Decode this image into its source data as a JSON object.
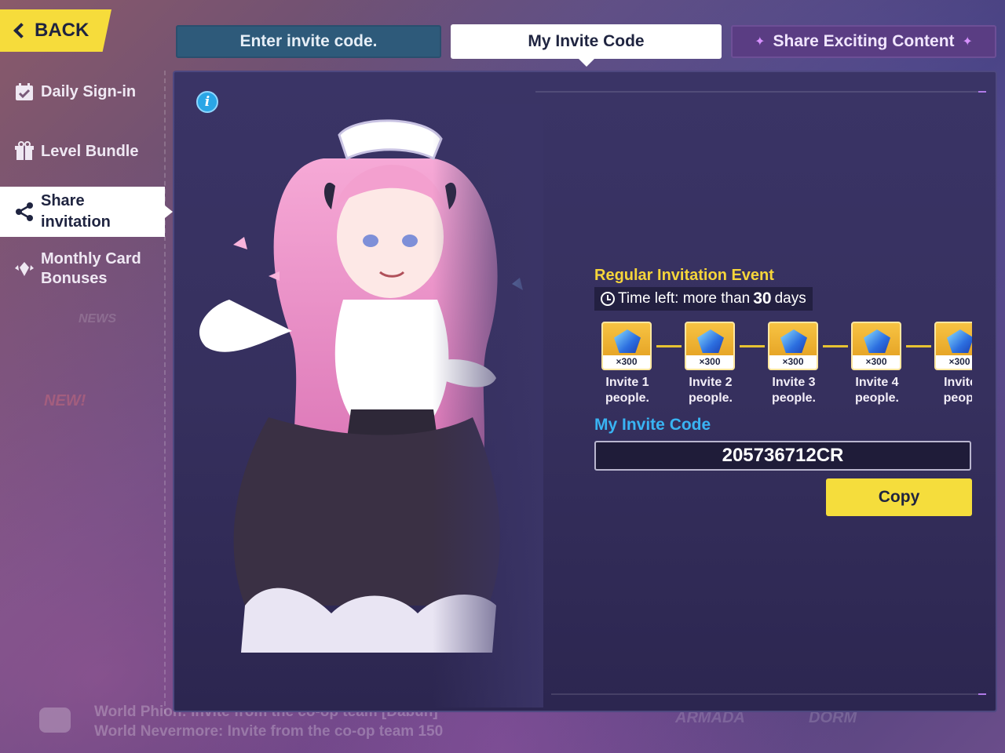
{
  "back_label": "BACK",
  "sidebar": {
    "items": [
      {
        "label": "Daily Sign-in",
        "icon": "calendar-check-icon"
      },
      {
        "label": "Level Bundle",
        "icon": "gift-icon"
      },
      {
        "label": "Share invitation",
        "icon": "share-icon",
        "active": true
      },
      {
        "label": "Monthly Card Bonuses",
        "icon": "crystal-wing-icon"
      }
    ]
  },
  "tabs": {
    "enter": "Enter invite code.",
    "mine": "My Invite Code",
    "share": "Share Exciting Content",
    "sparkle": "✦"
  },
  "event": {
    "title": "Regular Invitation Event",
    "time_prefix": "Time left: more than ",
    "time_value": "30",
    "time_suffix": " days"
  },
  "rewards": [
    {
      "qty": "×300",
      "label_a": "Invite ",
      "count": "1",
      "label_b": "people."
    },
    {
      "qty": "×300",
      "label_a": "Invite ",
      "count": "2",
      "label_b": "people."
    },
    {
      "qty": "×300",
      "label_a": "Invite ",
      "count": "3",
      "label_b": "people."
    },
    {
      "qty": "×300",
      "label_a": "Invite ",
      "count": "4",
      "label_b": "people."
    },
    {
      "qty": "×300",
      "label_a": "Invite",
      "count": "",
      "label_b": "peopl"
    }
  ],
  "invite_code": {
    "title": "My Invite Code",
    "value": "205736712CR",
    "copy_label": "Copy"
  },
  "background_chat": [
    "World Phion: Invite from the co-op team [Dabun]",
    "World Nevermore: Invite from the co-op team 150"
  ],
  "colors": {
    "accent_yellow": "#f5dd3c",
    "title_yellow": "#f6d53a",
    "code_blue": "#39b4f3",
    "panel": "#36305e"
  }
}
